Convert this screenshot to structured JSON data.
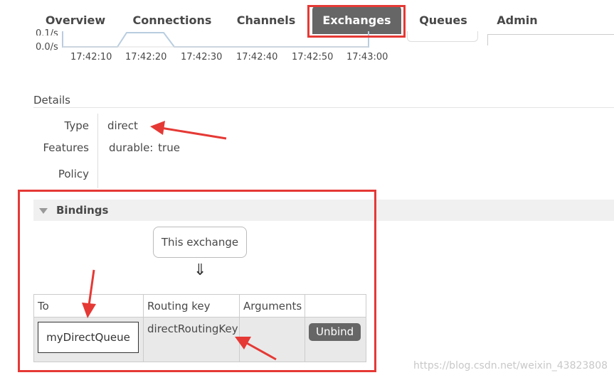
{
  "tabs": [
    {
      "label": "Overview",
      "active": false
    },
    {
      "label": "Connections",
      "active": false
    },
    {
      "label": "Channels",
      "active": false
    },
    {
      "label": "Exchanges",
      "active": true
    },
    {
      "label": "Queues",
      "active": false
    },
    {
      "label": "Admin",
      "active": false
    }
  ],
  "chart": {
    "y_labels": [
      "0.1/s",
      "0.0/s"
    ],
    "x_labels": [
      "17:42:10",
      "17:42:20",
      "17:42:30",
      "17:42:40",
      "17:42:50",
      "17:43:00"
    ],
    "line_color": "#b9cde0"
  },
  "details": {
    "title": "Details",
    "type_label": "Type",
    "type_value": "direct",
    "features_label": "Features",
    "features_key": "durable:",
    "features_value": "true",
    "policy_label": "Policy"
  },
  "bindings": {
    "title": "Bindings",
    "this_exchange": "This exchange",
    "arrow": "⇓",
    "headers": [
      "To",
      "Routing key",
      "Arguments",
      ""
    ],
    "rows": [
      {
        "to": "myDirectQueue",
        "routing_key": "directRoutingKey",
        "arguments": "",
        "action": "Unbind"
      }
    ]
  },
  "colors": {
    "tab_active": "#666666",
    "annotation": "#e53935",
    "text": "#484848"
  },
  "watermark": "https://blog.csdn.net/weixin_43823808"
}
